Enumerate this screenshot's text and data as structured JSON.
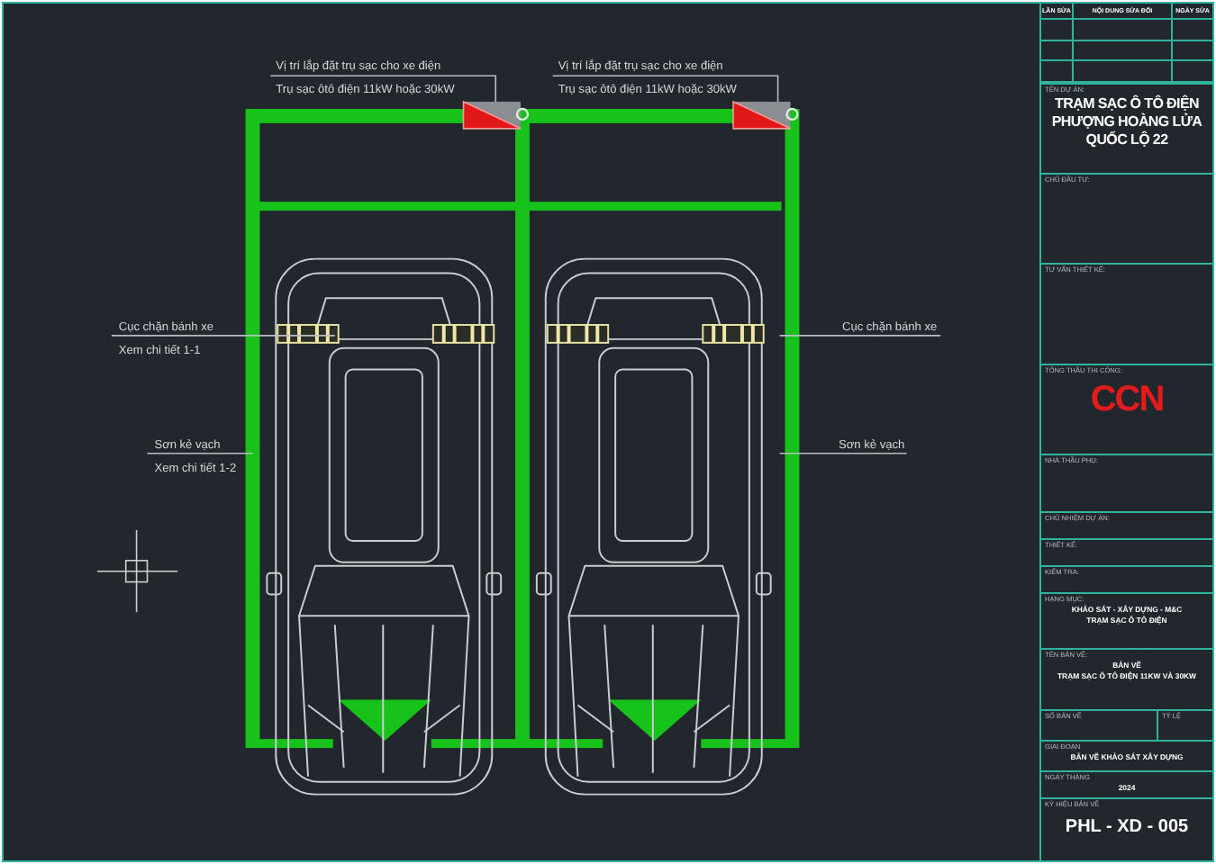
{
  "drawing": {
    "callouts": [
      {
        "kind": "charger",
        "lines": [
          "Vị trí lắp đặt trụ sạc cho xe điện",
          "Trụ sạc ôtô điện 11kW hoặc 30kW"
        ]
      },
      {
        "kind": "charger",
        "lines": [
          "Vị trí lắp đặt trụ sạc cho xe điện",
          "Trụ sạc ôtô điện 11kW hoặc 30kW"
        ]
      },
      {
        "kind": "left",
        "lines": [
          "Cục chặn bánh xe",
          "Xem chi tiết 1-1"
        ]
      },
      {
        "kind": "left",
        "lines": [
          "Sơn kẻ vạch",
          "Xem chi tiết 1-2"
        ]
      },
      {
        "kind": "right",
        "lines": [
          "Cục chặn bánh xe"
        ]
      },
      {
        "kind": "right",
        "lines": [
          "Sơn kẻ vạch"
        ]
      }
    ]
  },
  "title_block": {
    "revision_header": [
      "LẦN SỬA",
      "NỘI DUNG SỬA ĐỔI",
      "NGÀY SỬA"
    ],
    "sections": [
      {
        "kind": "title",
        "label": "TÊN DỰ ÁN:",
        "lines": [
          "TRẠM SẠC Ô TÔ ĐIỆN",
          "PHƯỢNG HOÀNG LỬA",
          "QUỐC LỘ 22"
        ]
      },
      {
        "kind": "blank",
        "label": "CHỦ ĐẦU TƯ:"
      },
      {
        "kind": "blank",
        "label": "TƯ VẤN THIẾT KẾ:"
      },
      {
        "kind": "logo",
        "label": "TỔNG THẦU THI CÔNG:",
        "logo": "CCN"
      },
      {
        "kind": "blank",
        "label": "NHÀ THẦU PHỤ:"
      },
      {
        "kind": "blank",
        "label": "CHỦ NHIỆM DỰ ÁN:"
      },
      {
        "kind": "blank",
        "label": "THIẾT KẾ:"
      },
      {
        "kind": "blank",
        "label": "KIỂM TRA:"
      },
      {
        "kind": "text",
        "label": "HẠNG MỤC:",
        "lines": [
          "KHẢO SÁT - XÂY DỰNG - M&C",
          "TRẠM SẠC Ô TÔ ĐIỆN"
        ]
      },
      {
        "kind": "text",
        "label": "TÊN BẢN VẼ:",
        "lines": [
          "BẢN VẼ",
          "TRẠM SẠC Ô TÔ ĐIỆN 11KW VÀ 30KW"
        ]
      },
      {
        "kind": "split",
        "labels": [
          "SỐ BẢN VẼ",
          "TỶ LỆ"
        ]
      },
      {
        "kind": "text",
        "label": "GIAI ĐOẠN",
        "lines": [
          "BẢN VẼ KHẢO SÁT XÂY DỰNG"
        ]
      },
      {
        "kind": "text",
        "label": "NGÀY THÁNG",
        "lines": [
          "2024"
        ]
      },
      {
        "kind": "code",
        "label": "KÝ HIỆU BẢN VẼ",
        "lines": [
          "PHL - XD - 005"
        ]
      }
    ]
  }
}
